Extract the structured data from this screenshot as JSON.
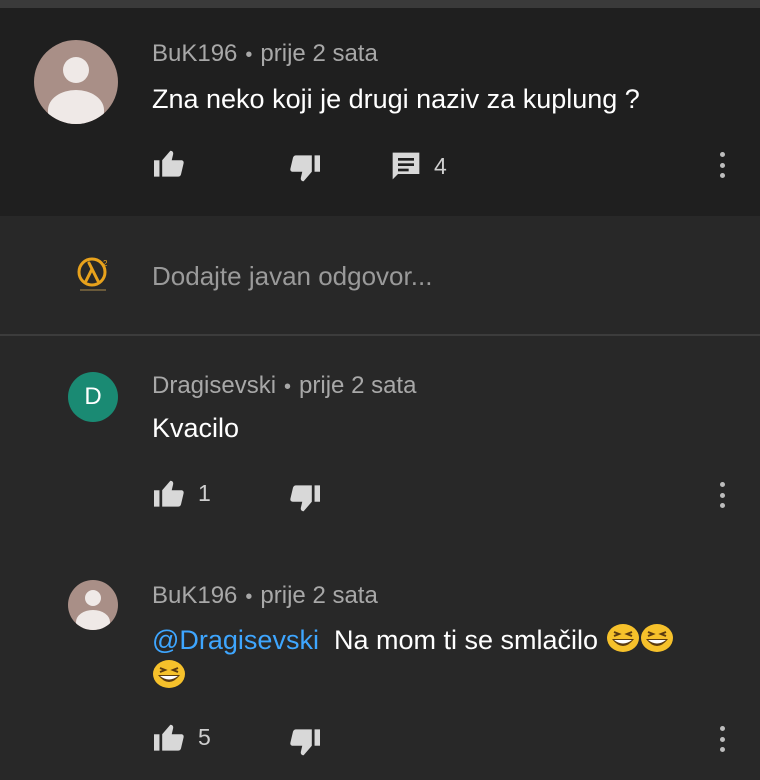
{
  "thread": {
    "author": "BuK196",
    "time": "prije 2 sata",
    "text": "Zna neko koji je drugi naziv za kuplung ?",
    "reply_count": "4"
  },
  "reply_box": {
    "placeholder": "Dodajte javan odgovor..."
  },
  "replies": [
    {
      "author": "Dragisevski",
      "avatar_letter": "D",
      "avatar_color": "#1a8a73",
      "time": "prije 2 sata",
      "text": "Kvacilo",
      "likes": "1"
    },
    {
      "author": "BuK196",
      "time": "prije 2 sata",
      "mention": "@Dragisevski",
      "text": "Na mom ti se smlačilo",
      "emojis": [
        "grinning-squinting-face",
        "grinning-squinting-face",
        "grinning-squinting-face"
      ],
      "likes": "5"
    }
  ],
  "icons": [
    "thumb-up-icon",
    "thumb-down-icon",
    "reply-comment-icon",
    "more-vert-icon",
    "half-life-logo-icon"
  ],
  "colors": {
    "background": "#282828",
    "comment_background": "#1f1f1f",
    "mention": "#3ea6ff",
    "meta_text": "#a8a8a8",
    "avatar_photo": "#a98f87"
  }
}
